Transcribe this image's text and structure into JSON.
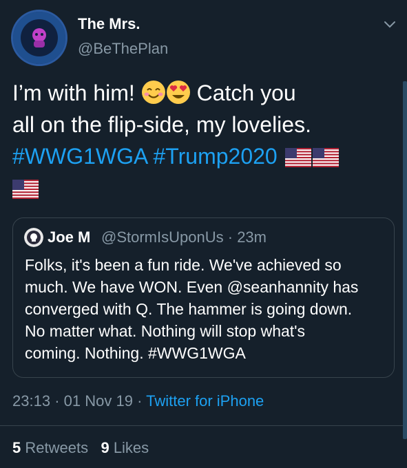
{
  "tweet": {
    "display_name": "The Mrs.",
    "handle": "@BeThePlan",
    "text_line1_a": "I’m with him! ",
    "text_line1_b": " Catch you",
    "text_line2": "all on the flip-side, my lovelies.",
    "hashtag1": "#WWG1WGA",
    "hashtag2": "#Trump2020",
    "emoji": [
      "smiling-face-icon",
      "heart-eyes-icon",
      "us-flag-icon"
    ]
  },
  "quote": {
    "name": "Joe M",
    "handle": "@StormIsUponUs",
    "separator": "·",
    "time": "23m",
    "lines": [
      "Folks, it's been a fun ride. We've achieved so",
      "much. We have WON. Even @seanhannity has",
      "converged with Q. The hammer is going down.",
      "No matter what. Nothing will stop what's",
      "coming. Nothing. #WWG1WGA"
    ]
  },
  "footer": {
    "time": "23:13",
    "separator": "·",
    "date": "01 Nov 19",
    "source": "Twitter for iPhone",
    "retweets_count": "5",
    "retweets_label": "Retweets",
    "likes_count": "9",
    "likes_label": "Likes"
  },
  "colors": {
    "background": "#15202b",
    "accent": "#1da1f2",
    "secondary_text": "#8899a6"
  }
}
